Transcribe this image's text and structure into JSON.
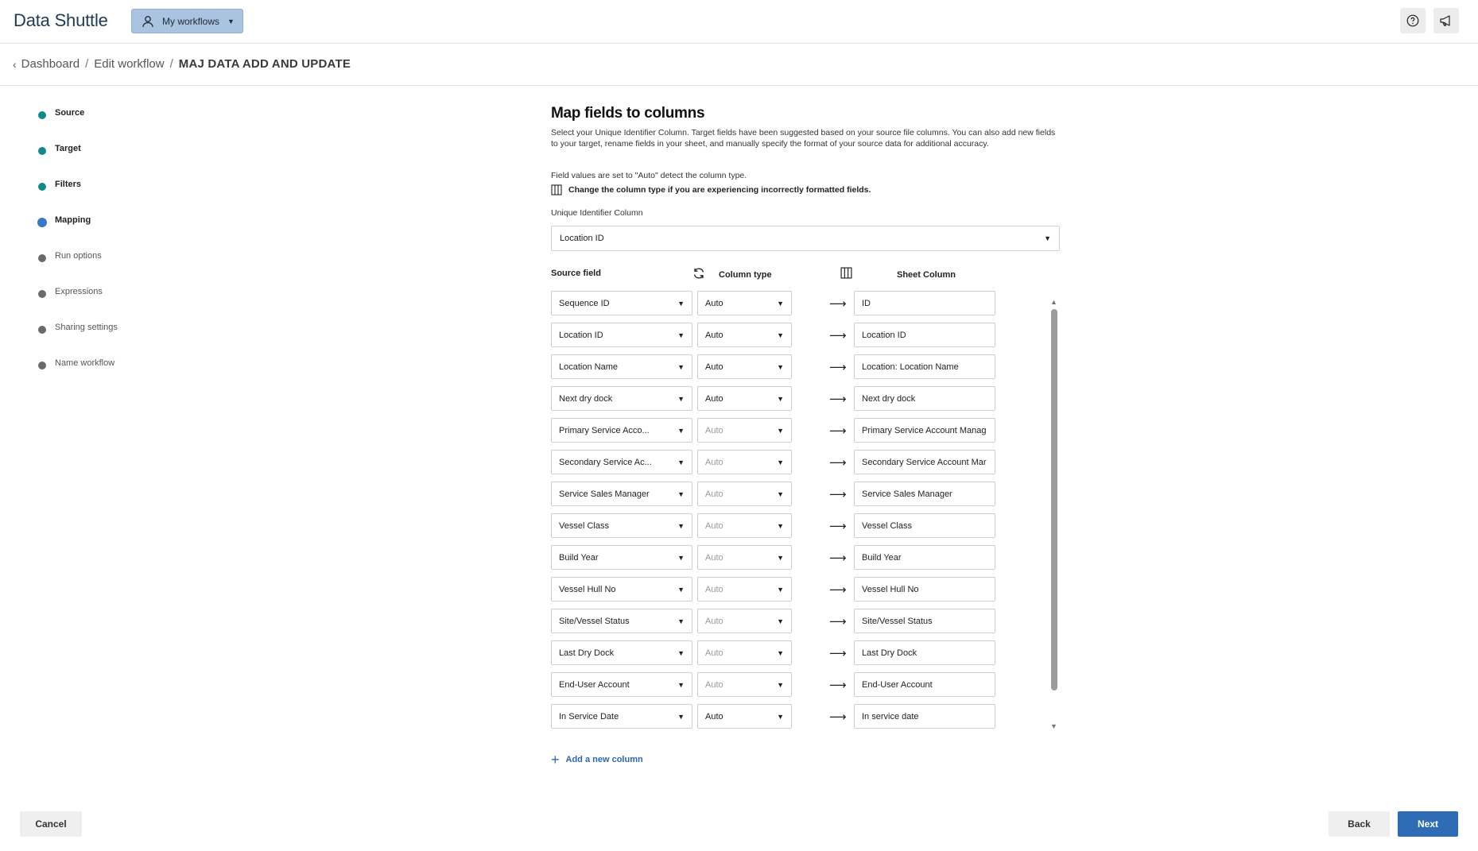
{
  "header": {
    "app_title": "Data Shuttle",
    "workflows_button": "My workflows",
    "help_icon": "help-circle-icon",
    "announce_icon": "megaphone-icon"
  },
  "breadcrumb": {
    "items": [
      "Dashboard",
      "Edit workflow"
    ],
    "separator": "/",
    "current": "MAJ DATA ADD AND UPDATE"
  },
  "steps": [
    {
      "label": "Source",
      "state": "done"
    },
    {
      "label": "Target",
      "state": "done"
    },
    {
      "label": "Filters",
      "state": "done"
    },
    {
      "label": "Mapping",
      "state": "active"
    },
    {
      "label": "Run options",
      "state": "todo"
    },
    {
      "label": "Expressions",
      "state": "todo"
    },
    {
      "label": "Sharing settings",
      "state": "todo"
    },
    {
      "label": "Name workflow",
      "state": "todo"
    }
  ],
  "main": {
    "title": "Map fields to columns",
    "description": "Select your Unique Identifier Column. Target fields have been suggested based on your source file columns. You can also add new fields to your target, rename fields in your sheet, and manually specify the format of your source data for additional accuracy.",
    "note_auto": "Field values are set to \"Auto\" detect the column type.",
    "note_change": "Change the column type if you are experiencing incorrectly formatted fields.",
    "uid_label": "Unique Identifier Column",
    "uid_value": "Location ID",
    "headers": {
      "source": "Source field",
      "type": "Column type",
      "sheet": "Sheet Column"
    },
    "rows": [
      {
        "source": "Sequence ID",
        "type": "Auto",
        "type_muted": false,
        "sheet": "ID"
      },
      {
        "source": "Location ID",
        "type": "Auto",
        "type_muted": false,
        "sheet": "Location ID"
      },
      {
        "source": "Location Name",
        "type": "Auto",
        "type_muted": false,
        "sheet": "Location: Location Name"
      },
      {
        "source": "Next dry dock",
        "type": "Auto",
        "type_muted": false,
        "sheet": "Next dry dock"
      },
      {
        "source": "Primary Service Acco...",
        "type": "Auto",
        "type_muted": true,
        "sheet": "Primary Service Account Manag"
      },
      {
        "source": "Secondary Service Ac...",
        "type": "Auto",
        "type_muted": true,
        "sheet": "Secondary Service Account Mar"
      },
      {
        "source": "Service Sales Manager",
        "type": "Auto",
        "type_muted": true,
        "sheet": "Service Sales Manager"
      },
      {
        "source": "Vessel Class",
        "type": "Auto",
        "type_muted": true,
        "sheet": "Vessel Class"
      },
      {
        "source": "Build Year",
        "type": "Auto",
        "type_muted": true,
        "sheet": "Build Year"
      },
      {
        "source": "Vessel Hull No",
        "type": "Auto",
        "type_muted": true,
        "sheet": "Vessel Hull No"
      },
      {
        "source": "Site/Vessel Status",
        "type": "Auto",
        "type_muted": true,
        "sheet": "Site/Vessel Status"
      },
      {
        "source": "Last Dry Dock",
        "type": "Auto",
        "type_muted": true,
        "sheet": "Last Dry Dock"
      },
      {
        "source": "End-User Account",
        "type": "Auto",
        "type_muted": true,
        "sheet": "End-User Account"
      },
      {
        "source": "In Service Date",
        "type": "Auto",
        "type_muted": false,
        "sheet": "In service date"
      },
      {
        "source": "",
        "type": "",
        "type_muted": false,
        "sheet": ""
      }
    ],
    "add_column": "Add a new column"
  },
  "footer": {
    "cancel": "Cancel",
    "back": "Back",
    "next": "Next"
  },
  "colors": {
    "accent": "#2e6db6",
    "step_done": "#138a8a",
    "workflows_bg": "#a9c3e0"
  }
}
